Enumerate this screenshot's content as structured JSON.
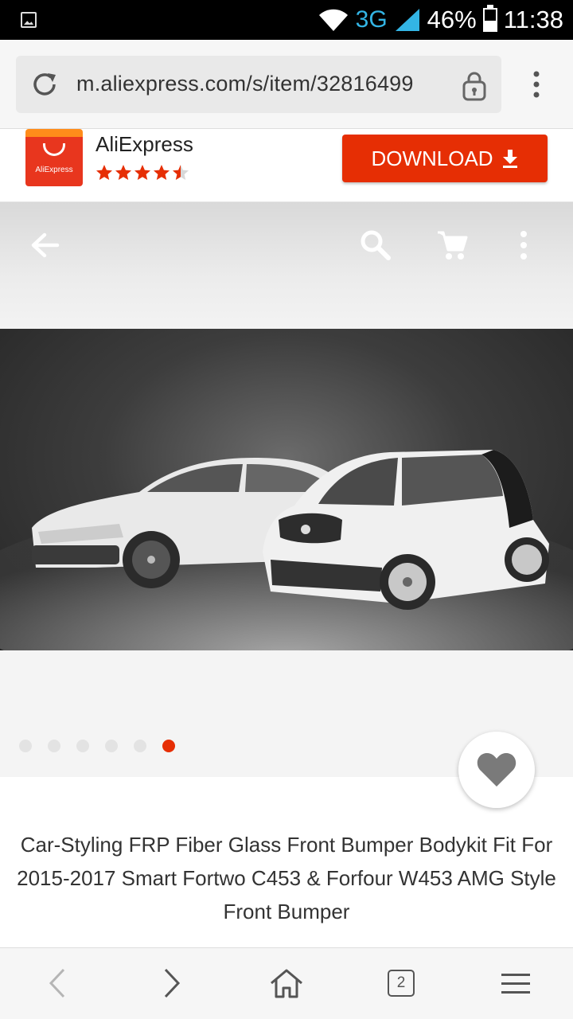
{
  "status_bar": {
    "network": "3G",
    "battery": "46%",
    "battery_level": 0.46,
    "time": "11:38",
    "icons": [
      "gallery-icon",
      "wifi-icon",
      "signal-icon",
      "battery-icon"
    ]
  },
  "browser": {
    "url": "m.aliexpress.com/s/item/32816499",
    "tab_count": "2",
    "icons": [
      "reload-icon",
      "lock-icon",
      "more-vertical-icon",
      "back-icon",
      "forward-icon",
      "home-icon",
      "tabs-icon",
      "menu-icon"
    ]
  },
  "app_banner": {
    "logo_text": "AliExpress",
    "name": "AliExpress",
    "rating": 4.5,
    "rating_max": 5,
    "download_label": "DOWNLOAD",
    "colors": {
      "accent": "#e62e04",
      "star": "#e62e04"
    }
  },
  "product": {
    "image_count": 6,
    "active_image": 6,
    "title": "Car-Styling FRP Fiber Glass Front Bumper Bodykit Fit For 2015-2017 Smart Fortwo C453 & Forfour W453 AMG Style Front Bumper",
    "nav_icons": [
      "arrow-back-icon",
      "search-icon",
      "cart-icon",
      "more-vertical-icon"
    ],
    "wishlist_icon": "heart-icon"
  }
}
